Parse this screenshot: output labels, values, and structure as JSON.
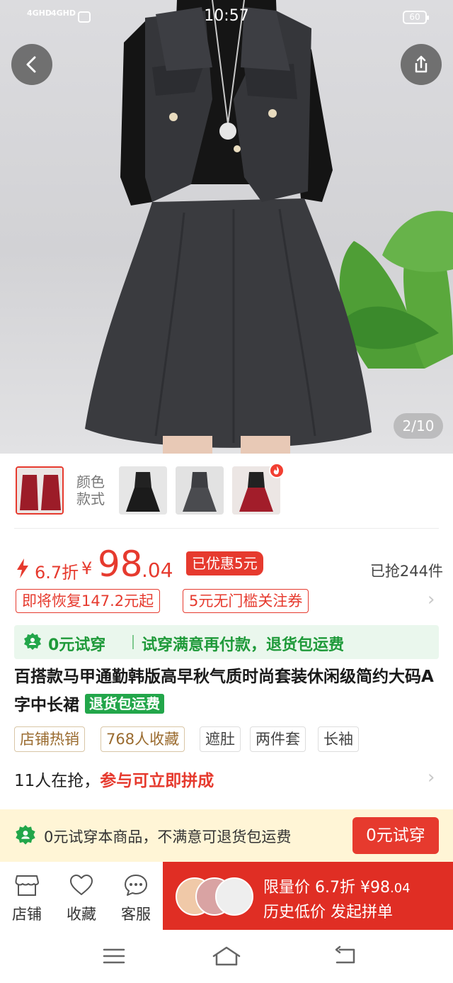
{
  "status_bar": {
    "net1": "4GHD",
    "net2": "4GHD",
    "time": "10:57",
    "battery": "60"
  },
  "hero": {
    "counter": "2/10",
    "icons": {
      "back": "back-arrow-icon",
      "share": "share-icon"
    }
  },
  "variants": {
    "label": "颜色款式",
    "thumbs": [
      "red-suit",
      "black-suit",
      "gray-suit",
      "red-suit-2"
    ],
    "hot_icon": "flame-icon"
  },
  "price": {
    "discount": "6.7折",
    "currency": "¥",
    "integer": "98",
    "decimal": ".04",
    "saved": "已优惠5元",
    "sold": "已抢244件"
  },
  "coupons": [
    "即将恢复147.2元起",
    "5元无门槛关注券"
  ],
  "trial_banner": {
    "left": "0元试穿",
    "right": "试穿满意再付款，退货包运费"
  },
  "product": {
    "title": "百搭款马甲通勤韩版高早秋气质时尚套装休闲级简约大码A字中长裙",
    "return_tag": "退货包运费"
  },
  "tags": [
    "店铺热销",
    "768人收藏",
    "遮肚",
    "两件套",
    "长袖"
  ],
  "group": {
    "count_text": "11人在抢，",
    "cta": "参与可立即拼成"
  },
  "trial_bar": {
    "text": "0元试穿本商品，不满意可退货包运费",
    "button": "0元试穿"
  },
  "actions": {
    "shop": "店铺",
    "favorite": "收藏",
    "service": "客服"
  },
  "buy": {
    "line1": "限量价 6.7折 ¥98",
    "line1_decimal": ".04",
    "line2": "历史低价 发起拼单"
  },
  "colors": {
    "accent": "#e63a2e",
    "green": "#1f9a3a",
    "buy_bg": "#e02e24",
    "trial_bg": "#fff5d6"
  }
}
